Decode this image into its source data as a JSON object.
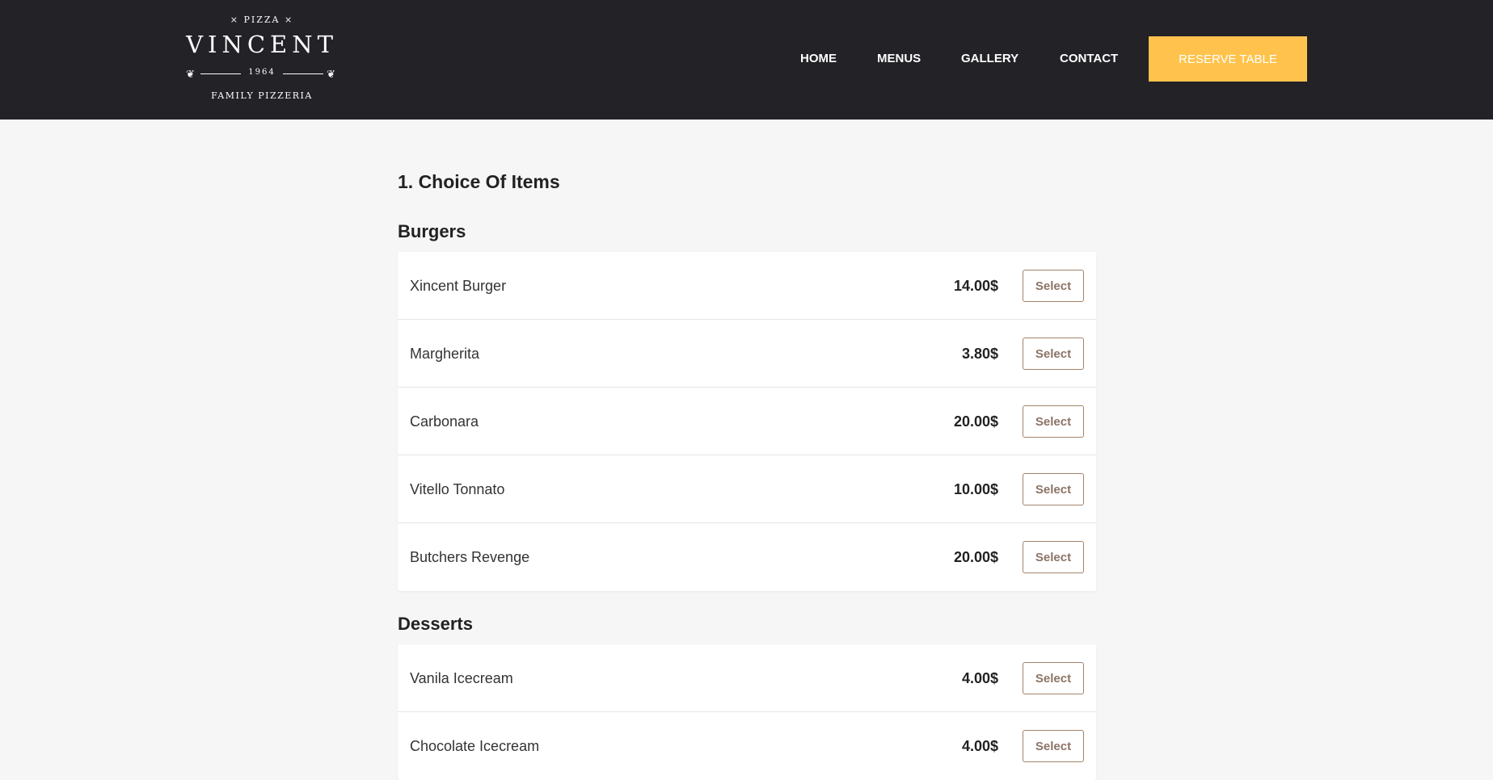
{
  "brand": {
    "top_text": "× PIZZA ×",
    "name": "VINCENT",
    "year": "1964",
    "tagline": "FAMILY PIZZERIA"
  },
  "nav": {
    "items": [
      "HOME",
      "MENUS",
      "GALLERY",
      "CONTACT"
    ],
    "cta_label": "RESERVE TABLE"
  },
  "main": {
    "section_title": "1. Choice Of Items",
    "categories": [
      {
        "title": "Burgers",
        "items": [
          {
            "name": "Xincent Burger",
            "price": "14.00$",
            "action": "Select"
          },
          {
            "name": "Margherita",
            "price": "3.80$",
            "action": "Select"
          },
          {
            "name": "Carbonara",
            "price": "20.00$",
            "action": "Select"
          },
          {
            "name": "Vitello Tonnato",
            "price": "10.00$",
            "action": "Select"
          },
          {
            "name": "Butchers Revenge",
            "price": "20.00$",
            "action": "Select"
          }
        ]
      },
      {
        "title": "Desserts",
        "items": [
          {
            "name": "Vanila Icecream",
            "price": "4.00$",
            "action": "Select"
          },
          {
            "name": "Chocolate Icecream",
            "price": "4.00$",
            "action": "Select"
          }
        ]
      }
    ]
  },
  "colors": {
    "header_bg": "#222227",
    "page_bg": "#f6f6f6",
    "accent": "#ffc34d",
    "select_border": "#a3836a"
  }
}
